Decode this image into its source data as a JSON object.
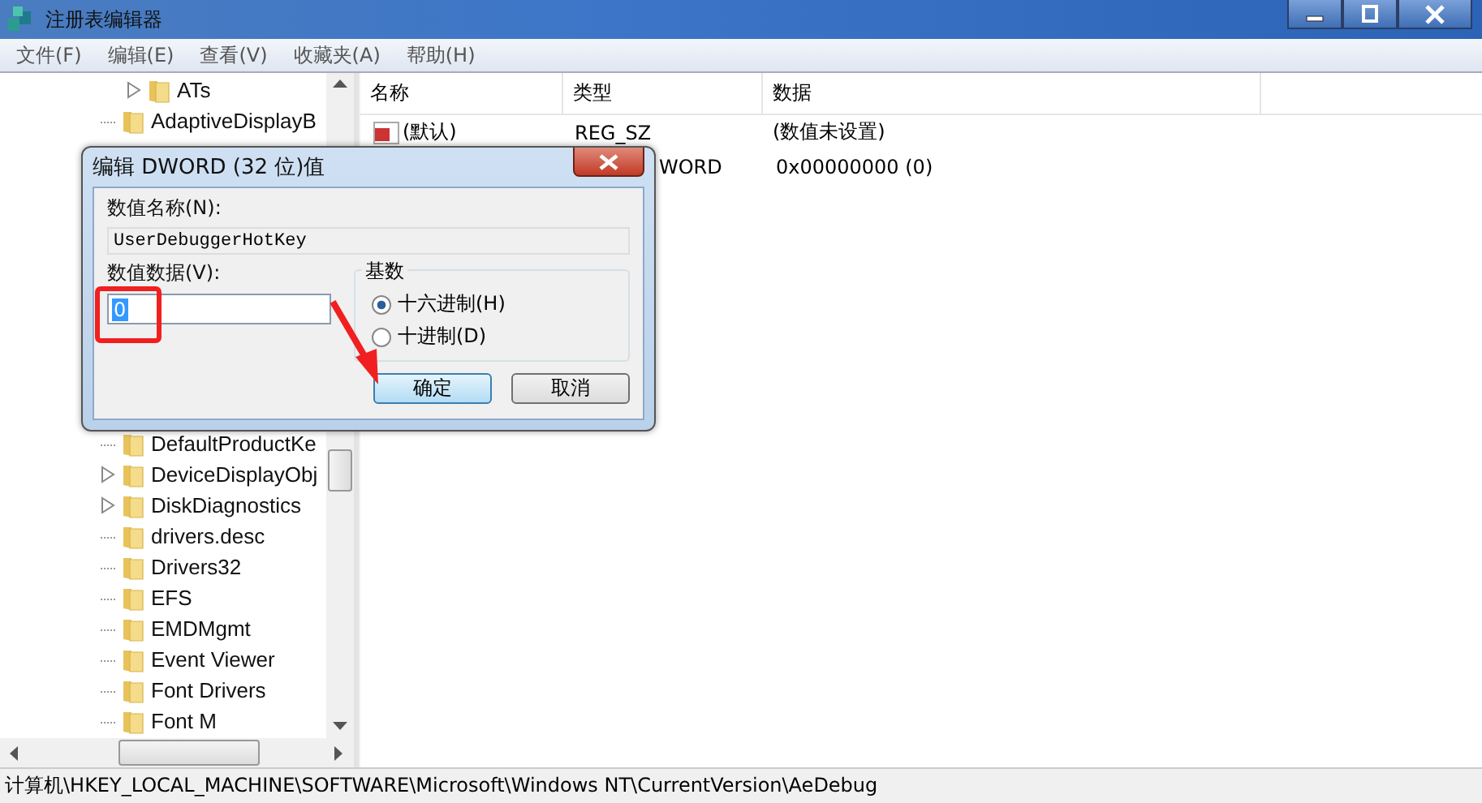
{
  "window": {
    "title": "注册表编辑器"
  },
  "menu": [
    "文件(F)",
    "编辑(E)",
    "查看(V)",
    "收藏夹(A)",
    "帮助(H)"
  ],
  "tree": {
    "top": [
      {
        "label": "ATs",
        "expandable": true
      },
      {
        "label": "AdaptiveDisplayB",
        "expandable": false
      }
    ],
    "bottom": [
      {
        "label": "DefaultProductKe",
        "expandable": false
      },
      {
        "label": "DeviceDisplayObj",
        "expandable": true
      },
      {
        "label": "DiskDiagnostics",
        "expandable": true
      },
      {
        "label": "drivers.desc",
        "expandable": false
      },
      {
        "label": "Drivers32",
        "expandable": false
      },
      {
        "label": "EFS",
        "expandable": false
      },
      {
        "label": "EMDMgmt",
        "expandable": false
      },
      {
        "label": "Event Viewer",
        "expandable": false
      },
      {
        "label": "Font Drivers",
        "expandable": false
      },
      {
        "label": "Font M",
        "expandable": false
      }
    ]
  },
  "list": {
    "columns": [
      "名称",
      "类型",
      "数据"
    ],
    "rows": [
      {
        "name": "(默认)",
        "type": "REG_SZ",
        "data": "(数值未设置)"
      },
      {
        "type": "WORD",
        "data": "0x00000000 (0)"
      }
    ]
  },
  "dialog": {
    "title": "编辑 DWORD (32 位)值",
    "name_label": "数值名称(N):",
    "name_value": "UserDebuggerHotKey",
    "data_label": "数值数据(V):",
    "data_value": "0",
    "base_label": "基数",
    "bases": [
      {
        "label": "十六进制(H)",
        "selected": true
      },
      {
        "label": "十进制(D)",
        "selected": false
      }
    ],
    "ok": "确定",
    "cancel": "取消"
  },
  "status_bar": "计算机\\HKEY_LOCAL_MACHINE\\SOFTWARE\\Microsoft\\Windows NT\\CurrentVersion\\AeDebug"
}
